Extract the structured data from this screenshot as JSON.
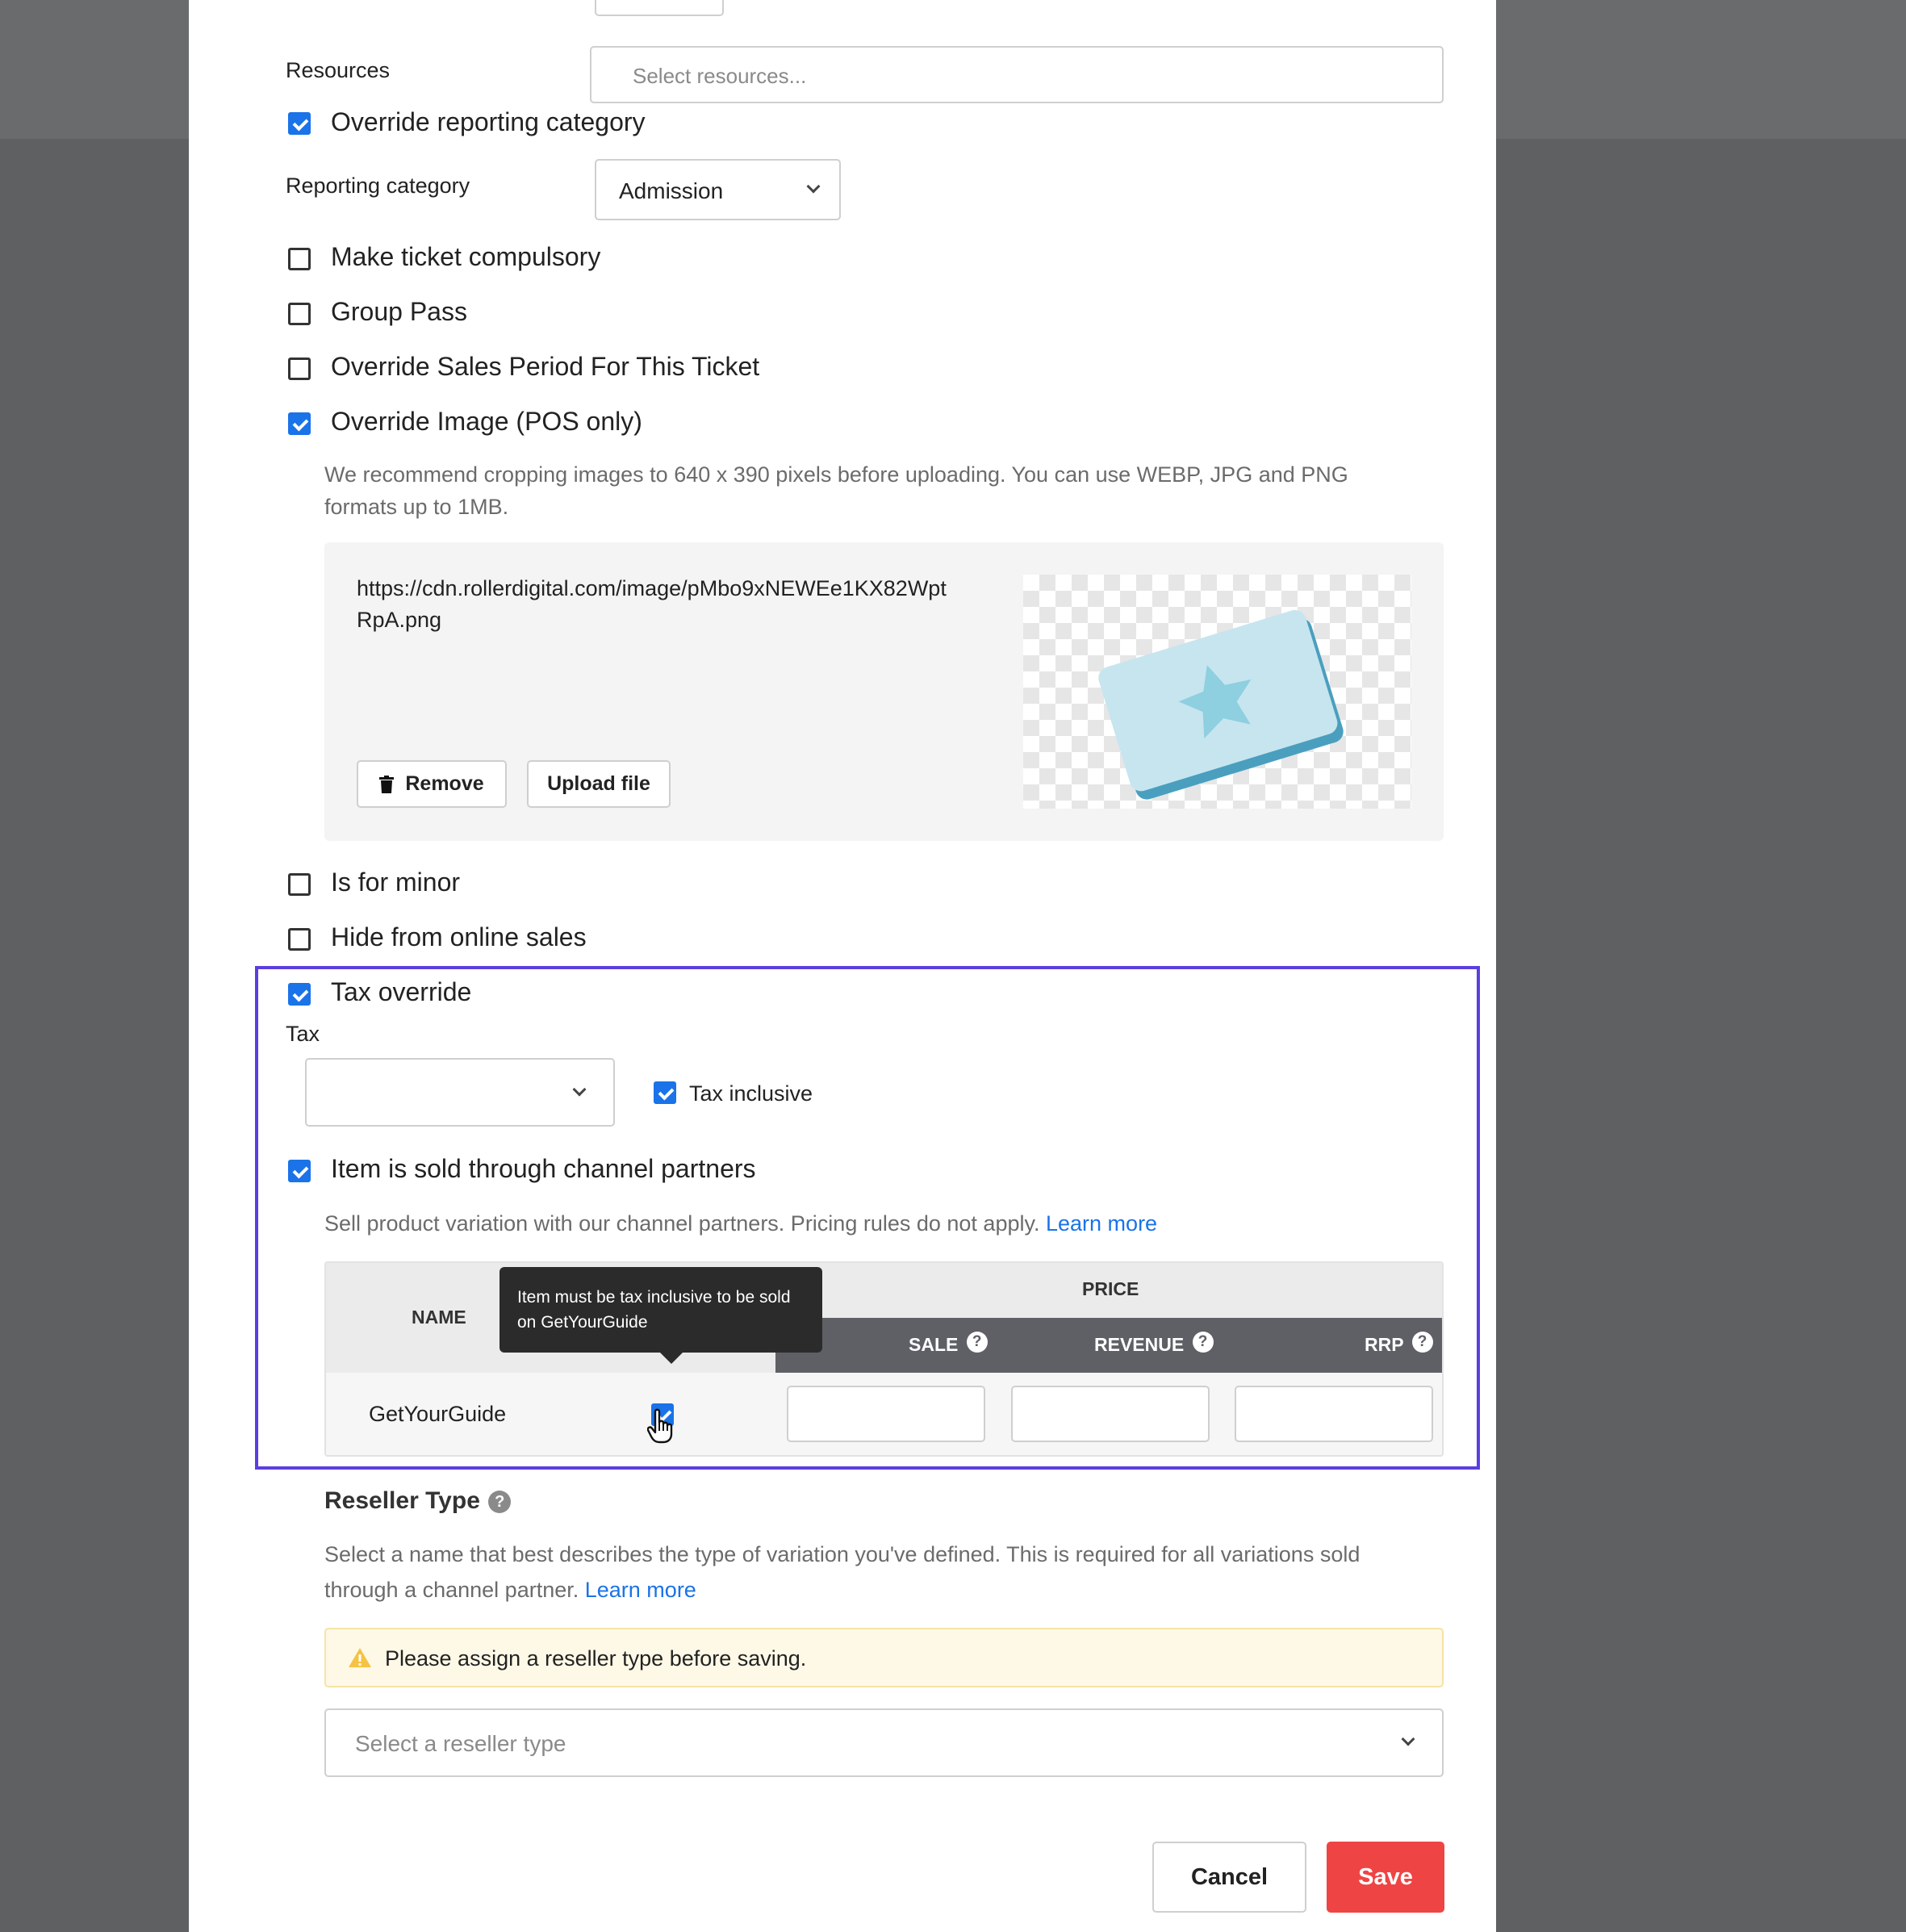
{
  "resources": {
    "label": "Resources",
    "placeholder": "Select resources..."
  },
  "override_reporting": {
    "label": "Override reporting category",
    "checked": true
  },
  "reporting_category": {
    "label": "Reporting category",
    "value": "Admission"
  },
  "options": [
    {
      "label": "Make ticket compulsory",
      "checked": false
    },
    {
      "label": "Group Pass",
      "checked": false
    },
    {
      "label": "Override Sales Period For This Ticket",
      "checked": false
    },
    {
      "label": "Override Image (POS only)",
      "checked": true
    }
  ],
  "image": {
    "hint": "We recommend cropping images to 640 x 390 pixels before uploading. You can use WEBP, JPG and PNG formats up to 1MB.",
    "url_line1": "https://cdn.rollerdigital.com/image/pMbo9xNEWEe1KX82Wpt",
    "url_line2": "RpA.png",
    "remove_label": "Remove",
    "upload_label": "Upload file"
  },
  "minor": {
    "label": "Is for minor",
    "checked": false
  },
  "hide_online": {
    "label": "Hide from online sales",
    "checked": false
  },
  "tax": {
    "override_label": "Tax override",
    "override_checked": true,
    "tax_label": "Tax",
    "tax_value": "",
    "inclusive_label": "Tax inclusive",
    "inclusive_checked": true
  },
  "channel": {
    "label": "Item is sold through channel partners",
    "checked": true,
    "desc": "Sell product variation with our channel partners. Pricing rules do not apply.",
    "learn_more": "Learn more",
    "table": {
      "name_header": "NAME",
      "price_header": "PRICE",
      "sale_header": "SALE",
      "revenue_header": "REVENUE",
      "rrp_header": "RRP",
      "row": {
        "name": "GetYourGuide",
        "checked": true,
        "sale": "",
        "revenue": "",
        "rrp": ""
      }
    },
    "tooltip": "Item must be tax inclusive to be sold on GetYourGuide"
  },
  "reseller": {
    "title": "Reseller Type",
    "desc_line1": "Select a name that best describes the type of variation you've defined. This is required for all variations sold",
    "desc_line2": "through a channel partner.",
    "learn_more": "Learn more",
    "warning": "Please assign a reseller type before saving.",
    "placeholder": "Select a reseller type"
  },
  "footer": {
    "cancel": "Cancel",
    "save": "Save"
  },
  "colors": {
    "accent": "#1a73e8",
    "highlight": "#5b3fe0",
    "save": "#ef4444",
    "warning_bg": "#fef9e7"
  }
}
